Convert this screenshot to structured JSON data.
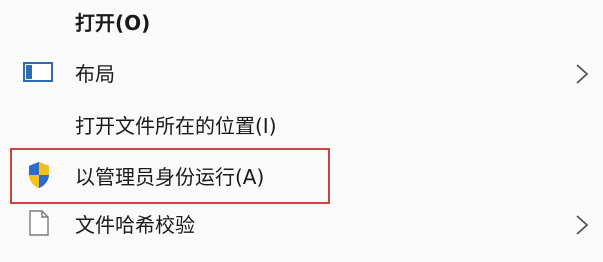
{
  "context_menu": {
    "items": [
      {
        "label": "打开(O)",
        "icon": "none",
        "bold": true,
        "submenu": false
      },
      {
        "label": "布局",
        "icon": "layout-icon",
        "bold": false,
        "submenu": true
      },
      {
        "label": "打开文件所在的位置(I)",
        "icon": "none",
        "bold": false,
        "submenu": false
      },
      {
        "label": "以管理员身份运行(A)",
        "icon": "uac-shield-icon",
        "bold": false,
        "submenu": false,
        "highlighted": true
      },
      {
        "label": "文件哈希校验",
        "icon": "file-icon",
        "bold": false,
        "submenu": true
      }
    ],
    "highlight_color": "#c9443f"
  }
}
